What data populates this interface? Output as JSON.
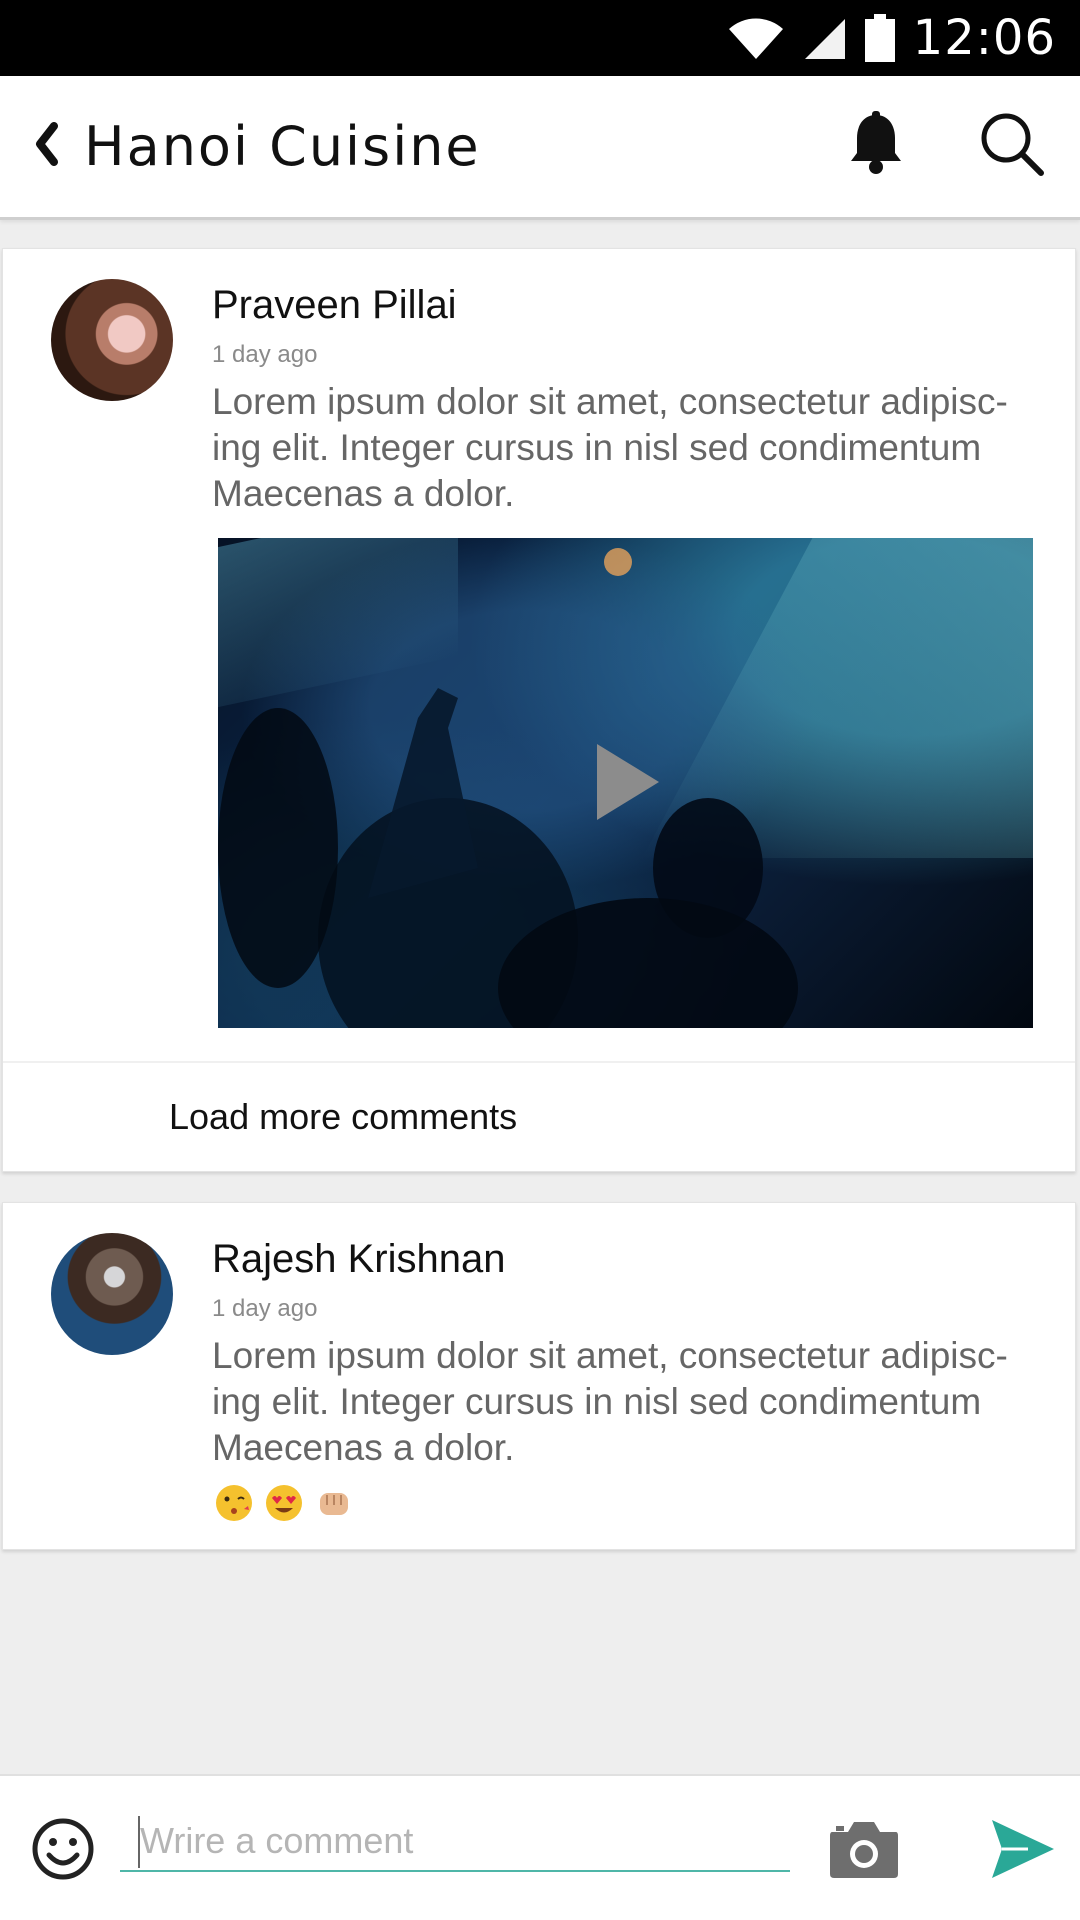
{
  "status_bar": {
    "time": "12:06",
    "icons": [
      "wifi-icon",
      "signal-icon",
      "battery-icon"
    ]
  },
  "header": {
    "title": "Hanoi Cuisine",
    "icons": [
      "back-chevron-icon",
      "bell-icon",
      "search-icon"
    ]
  },
  "posts": [
    {
      "author": "Praveen Pillai",
      "time_ago": "1 day ago",
      "text": "Lorem ipsum dolor sit amet, consectetur adipisc-ing elit. Integer cursus in nisl sed condimentum Maecenas a dolor.",
      "media": {
        "type": "video",
        "icon": "play-icon"
      },
      "load_more_label": "Load more comments"
    },
    {
      "author": "Rajesh Krishnan",
      "time_ago": "1 day ago",
      "text": "Lorem ipsum dolor sit amet, consectetur adipisc-ing elit. Integer cursus in nisl sed condimentum Maecenas a dolor.",
      "emojis": [
        "kissing-face-emoji",
        "heart-eyes-emoji",
        "fist-emoji"
      ]
    }
  ],
  "composer": {
    "placeholder": "Wrire a comment",
    "icons": [
      "smiley-icon",
      "camera-icon",
      "send-icon"
    ]
  },
  "colors": {
    "accent": "#2aa897",
    "background": "#eeeeee",
    "status_bar": "#000000"
  }
}
